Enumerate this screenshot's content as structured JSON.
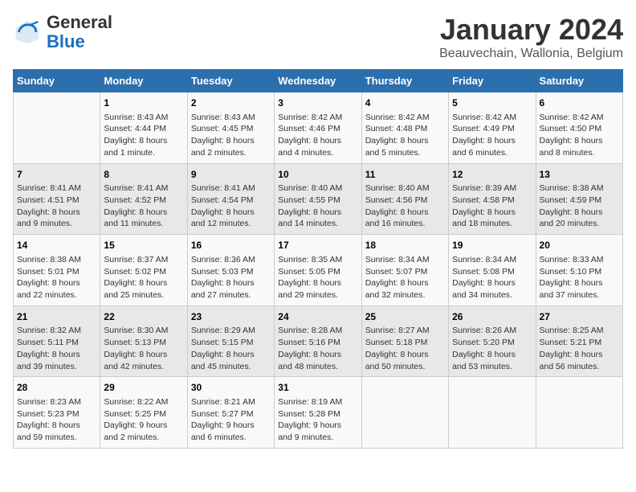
{
  "header": {
    "logo_general": "General",
    "logo_blue": "Blue",
    "title": "January 2024",
    "subtitle": "Beauvechain, Wallonia, Belgium"
  },
  "columns": [
    "Sunday",
    "Monday",
    "Tuesday",
    "Wednesday",
    "Thursday",
    "Friday",
    "Saturday"
  ],
  "weeks": [
    [
      {
        "day": "",
        "lines": []
      },
      {
        "day": "1",
        "lines": [
          "Sunrise: 8:43 AM",
          "Sunset: 4:44 PM",
          "Daylight: 8 hours",
          "and 1 minute."
        ]
      },
      {
        "day": "2",
        "lines": [
          "Sunrise: 8:43 AM",
          "Sunset: 4:45 PM",
          "Daylight: 8 hours",
          "and 2 minutes."
        ]
      },
      {
        "day": "3",
        "lines": [
          "Sunrise: 8:42 AM",
          "Sunset: 4:46 PM",
          "Daylight: 8 hours",
          "and 4 minutes."
        ]
      },
      {
        "day": "4",
        "lines": [
          "Sunrise: 8:42 AM",
          "Sunset: 4:48 PM",
          "Daylight: 8 hours",
          "and 5 minutes."
        ]
      },
      {
        "day": "5",
        "lines": [
          "Sunrise: 8:42 AM",
          "Sunset: 4:49 PM",
          "Daylight: 8 hours",
          "and 6 minutes."
        ]
      },
      {
        "day": "6",
        "lines": [
          "Sunrise: 8:42 AM",
          "Sunset: 4:50 PM",
          "Daylight: 8 hours",
          "and 8 minutes."
        ]
      }
    ],
    [
      {
        "day": "7",
        "lines": [
          "Sunrise: 8:41 AM",
          "Sunset: 4:51 PM",
          "Daylight: 8 hours",
          "and 9 minutes."
        ]
      },
      {
        "day": "8",
        "lines": [
          "Sunrise: 8:41 AM",
          "Sunset: 4:52 PM",
          "Daylight: 8 hours",
          "and 11 minutes."
        ]
      },
      {
        "day": "9",
        "lines": [
          "Sunrise: 8:41 AM",
          "Sunset: 4:54 PM",
          "Daylight: 8 hours",
          "and 12 minutes."
        ]
      },
      {
        "day": "10",
        "lines": [
          "Sunrise: 8:40 AM",
          "Sunset: 4:55 PM",
          "Daylight: 8 hours",
          "and 14 minutes."
        ]
      },
      {
        "day": "11",
        "lines": [
          "Sunrise: 8:40 AM",
          "Sunset: 4:56 PM",
          "Daylight: 8 hours",
          "and 16 minutes."
        ]
      },
      {
        "day": "12",
        "lines": [
          "Sunrise: 8:39 AM",
          "Sunset: 4:58 PM",
          "Daylight: 8 hours",
          "and 18 minutes."
        ]
      },
      {
        "day": "13",
        "lines": [
          "Sunrise: 8:38 AM",
          "Sunset: 4:59 PM",
          "Daylight: 8 hours",
          "and 20 minutes."
        ]
      }
    ],
    [
      {
        "day": "14",
        "lines": [
          "Sunrise: 8:38 AM",
          "Sunset: 5:01 PM",
          "Daylight: 8 hours",
          "and 22 minutes."
        ]
      },
      {
        "day": "15",
        "lines": [
          "Sunrise: 8:37 AM",
          "Sunset: 5:02 PM",
          "Daylight: 8 hours",
          "and 25 minutes."
        ]
      },
      {
        "day": "16",
        "lines": [
          "Sunrise: 8:36 AM",
          "Sunset: 5:03 PM",
          "Daylight: 8 hours",
          "and 27 minutes."
        ]
      },
      {
        "day": "17",
        "lines": [
          "Sunrise: 8:35 AM",
          "Sunset: 5:05 PM",
          "Daylight: 8 hours",
          "and 29 minutes."
        ]
      },
      {
        "day": "18",
        "lines": [
          "Sunrise: 8:34 AM",
          "Sunset: 5:07 PM",
          "Daylight: 8 hours",
          "and 32 minutes."
        ]
      },
      {
        "day": "19",
        "lines": [
          "Sunrise: 8:34 AM",
          "Sunset: 5:08 PM",
          "Daylight: 8 hours",
          "and 34 minutes."
        ]
      },
      {
        "day": "20",
        "lines": [
          "Sunrise: 8:33 AM",
          "Sunset: 5:10 PM",
          "Daylight: 8 hours",
          "and 37 minutes."
        ]
      }
    ],
    [
      {
        "day": "21",
        "lines": [
          "Sunrise: 8:32 AM",
          "Sunset: 5:11 PM",
          "Daylight: 8 hours",
          "and 39 minutes."
        ]
      },
      {
        "day": "22",
        "lines": [
          "Sunrise: 8:30 AM",
          "Sunset: 5:13 PM",
          "Daylight: 8 hours",
          "and 42 minutes."
        ]
      },
      {
        "day": "23",
        "lines": [
          "Sunrise: 8:29 AM",
          "Sunset: 5:15 PM",
          "Daylight: 8 hours",
          "and 45 minutes."
        ]
      },
      {
        "day": "24",
        "lines": [
          "Sunrise: 8:28 AM",
          "Sunset: 5:16 PM",
          "Daylight: 8 hours",
          "and 48 minutes."
        ]
      },
      {
        "day": "25",
        "lines": [
          "Sunrise: 8:27 AM",
          "Sunset: 5:18 PM",
          "Daylight: 8 hours",
          "and 50 minutes."
        ]
      },
      {
        "day": "26",
        "lines": [
          "Sunrise: 8:26 AM",
          "Sunset: 5:20 PM",
          "Daylight: 8 hours",
          "and 53 minutes."
        ]
      },
      {
        "day": "27",
        "lines": [
          "Sunrise: 8:25 AM",
          "Sunset: 5:21 PM",
          "Daylight: 8 hours",
          "and 56 minutes."
        ]
      }
    ],
    [
      {
        "day": "28",
        "lines": [
          "Sunrise: 8:23 AM",
          "Sunset: 5:23 PM",
          "Daylight: 8 hours",
          "and 59 minutes."
        ]
      },
      {
        "day": "29",
        "lines": [
          "Sunrise: 8:22 AM",
          "Sunset: 5:25 PM",
          "Daylight: 9 hours",
          "and 2 minutes."
        ]
      },
      {
        "day": "30",
        "lines": [
          "Sunrise: 8:21 AM",
          "Sunset: 5:27 PM",
          "Daylight: 9 hours",
          "and 6 minutes."
        ]
      },
      {
        "day": "31",
        "lines": [
          "Sunrise: 8:19 AM",
          "Sunset: 5:28 PM",
          "Daylight: 9 hours",
          "and 9 minutes."
        ]
      },
      {
        "day": "",
        "lines": []
      },
      {
        "day": "",
        "lines": []
      },
      {
        "day": "",
        "lines": []
      }
    ]
  ]
}
